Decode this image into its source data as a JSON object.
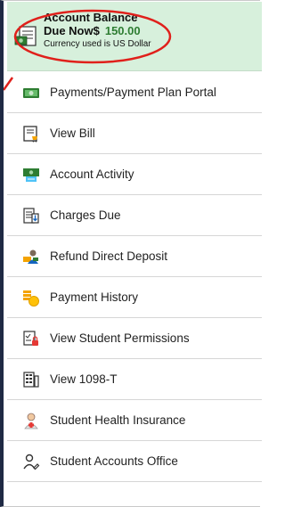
{
  "balance": {
    "title": "Account Balance",
    "due_label": "Due Now$",
    "amount": "150.00",
    "currency_note": "Currency used is US Dollar",
    "amount_color": "#2e7d32",
    "icon": "bill-icon"
  },
  "menu": {
    "items": [
      {
        "label": "Payments/Payment Plan Portal",
        "icon": "cash-payment-icon"
      },
      {
        "label": "View Bill",
        "icon": "bill-cart-icon"
      },
      {
        "label": "Account Activity",
        "icon": "money-activity-icon"
      },
      {
        "label": "Charges Due",
        "icon": "charges-list-icon"
      },
      {
        "label": "Refund Direct Deposit",
        "icon": "person-deposit-icon"
      },
      {
        "label": "Payment History",
        "icon": "coins-history-icon"
      },
      {
        "label": "View Student Permissions",
        "icon": "permissions-icon"
      },
      {
        "label": "View 1098-T",
        "icon": "tax-form-icon"
      },
      {
        "label": "Student Health Insurance",
        "icon": "health-insurance-icon"
      },
      {
        "label": "Student Accounts Office",
        "icon": "person-office-icon"
      }
    ]
  },
  "colors": {
    "balance_bg": "#d7f0dc",
    "highlight": "#e0201b",
    "border": "#1f2a44"
  }
}
